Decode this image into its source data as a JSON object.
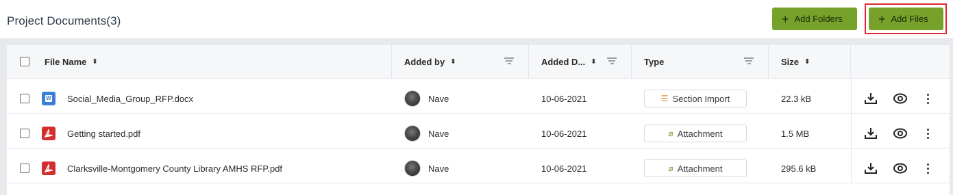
{
  "header": {
    "title": "Project Documents(3)",
    "add_folders_label": "Add Folders",
    "add_files_label": "Add Files",
    "accent_color": "#76a12b"
  },
  "table": {
    "columns": {
      "file_name": "File Name",
      "added_by": "Added by",
      "added_date": "Added D...",
      "type": "Type",
      "size": "Size"
    },
    "rows": [
      {
        "file_name": "Social_Media_Group_RFP.docx",
        "file_icon": "word-icon",
        "added_by": "Nave",
        "added_date": "10-06-2021",
        "type": "Section Import",
        "type_icon": "section-import-icon",
        "size": "22.3 kB"
      },
      {
        "file_name": "Getting started.pdf",
        "file_icon": "pdf-icon",
        "added_by": "Nave",
        "added_date": "10-06-2021",
        "type": "Attachment",
        "type_icon": "paperclip-icon",
        "size": "1.5 MB"
      },
      {
        "file_name": "Clarksville-Montgomery County Library AMHS RFP.pdf",
        "file_icon": "pdf-icon",
        "added_by": "Nave",
        "added_date": "10-06-2021",
        "type": "Attachment",
        "type_icon": "paperclip-icon",
        "size": "295.6 kB"
      }
    ]
  }
}
